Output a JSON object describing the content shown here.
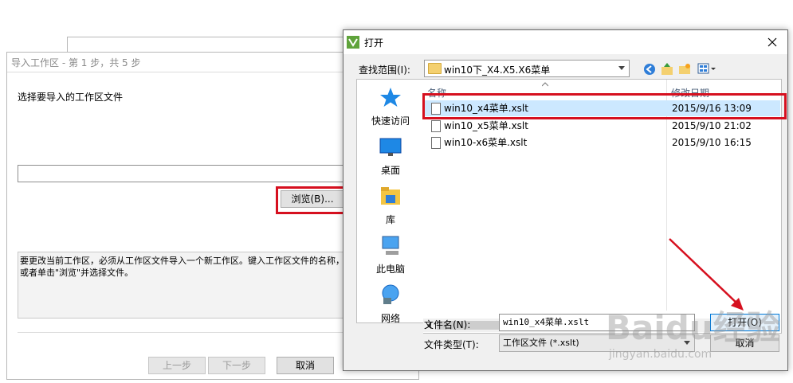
{
  "wizard": {
    "title": "导入工作区 - 第 1 步，共 5 步",
    "prompt": "选择要导入的工作区文件",
    "path_value": "",
    "browse_label": "浏览(B)...",
    "info_text": "要更改当前工作区，必须从工作区文件导入一个新工作区。键入工作区文件的名称，或者单击\"浏览\"并选择文件。",
    "back_label": "上一步",
    "next_label": "下一步",
    "cancel_label": "取消"
  },
  "dialog": {
    "title": "打开",
    "look_in_label": "查找范围(I):",
    "look_in_value": "win10下_X4.X5.X6菜单",
    "places": [
      "快速访问",
      "桌面",
      "库",
      "此电脑",
      "网络"
    ],
    "col_name": "名称",
    "col_date": "修改日期",
    "files": [
      {
        "name": "win10_x4菜单.xslt",
        "date": "2015/9/16 13:09",
        "selected": true
      },
      {
        "name": "win10_x5菜单.xslt",
        "date": "2015/9/10 21:02",
        "selected": false
      },
      {
        "name": "win10-x6菜单.xslt",
        "date": "2015/9/10 16:15",
        "selected": false
      }
    ],
    "filename_label": "文件名(N):",
    "filename_value": "win10_x4菜单.xslt",
    "filetype_label": "文件类型(T):",
    "filetype_value": "工作区文件 (*.xslt)",
    "open_label": "打开(O)",
    "cancel_label": "取消"
  },
  "watermark": {
    "brand": "Baidu经验",
    "url": "jingyan.baidu.com"
  },
  "colors": {
    "highlight": "#d6101f",
    "selection": "#cce8ff",
    "arrow": "#d6101f"
  }
}
